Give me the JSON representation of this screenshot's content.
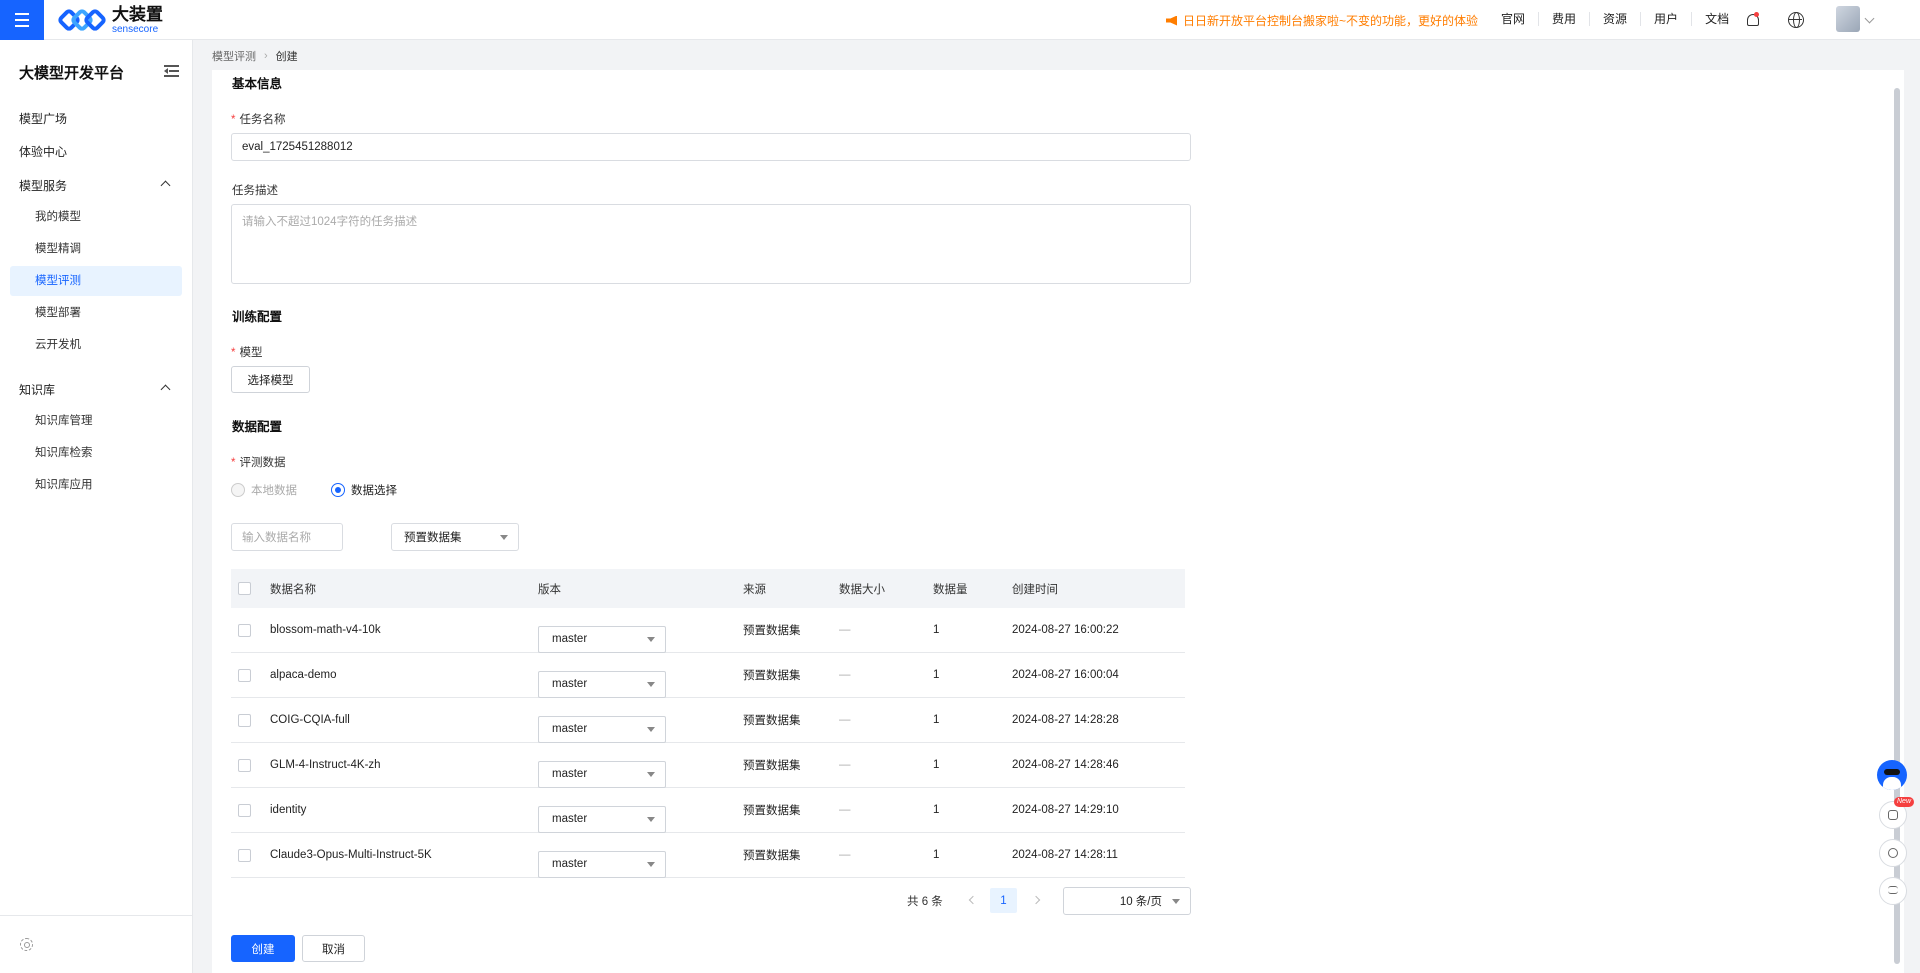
{
  "brand": {
    "name_cn": "大装置",
    "name_en": "sensecore"
  },
  "notice": "日日新开放平台控制台搬家啦~不变的功能，更好的体验",
  "topnav": [
    "官网",
    "费用",
    "资源",
    "用户",
    "文档"
  ],
  "sidebar": {
    "title": "大模型开发平台",
    "top_items": [
      "模型广场",
      "体验中心"
    ],
    "groups": [
      {
        "label": "模型服务",
        "items": [
          "我的模型",
          "模型精调",
          "模型评测",
          "模型部署",
          "云开发机"
        ]
      },
      {
        "label": "知识库",
        "items": [
          "知识库管理",
          "知识库检索",
          "知识库应用"
        ]
      }
    ],
    "active_item": "模型评测"
  },
  "breadcrumb": {
    "parent": "模型评测",
    "current": "创建"
  },
  "form": {
    "basic_title": "基本信息",
    "task_name_label": "任务名称",
    "task_name_value": "eval_1725451288012",
    "task_desc_label": "任务描述",
    "task_desc_placeholder": "请输入不超过1024字符的任务描述",
    "train_title": "训练配置",
    "model_label": "模型",
    "select_model_btn": "选择模型",
    "data_title": "数据配置",
    "eval_data_label": "评测数据",
    "radio_local": "本地数据",
    "radio_select": "数据选择",
    "search_placeholder": "输入数据名称",
    "dataset_type": "预置数据集"
  },
  "table": {
    "headers": [
      "数据名称",
      "版本",
      "来源",
      "数据大小",
      "数据量",
      "创建时间"
    ],
    "rows": [
      {
        "name": "blossom-math-v4-10k",
        "version": "master",
        "source": "预置数据集",
        "size": "—",
        "count": "1",
        "created": "2024-08-27 16:00:22"
      },
      {
        "name": "alpaca-demo",
        "version": "master",
        "source": "预置数据集",
        "size": "—",
        "count": "1",
        "created": "2024-08-27 16:00:04"
      },
      {
        "name": "COIG-CQIA-full",
        "version": "master",
        "source": "预置数据集",
        "size": "—",
        "count": "1",
        "created": "2024-08-27 14:28:28"
      },
      {
        "name": "GLM-4-Instruct-4K-zh",
        "version": "master",
        "source": "预置数据集",
        "size": "—",
        "count": "1",
        "created": "2024-08-27 14:28:46"
      },
      {
        "name": "identity",
        "version": "master",
        "source": "预置数据集",
        "size": "—",
        "count": "1",
        "created": "2024-08-27 14:29:10"
      },
      {
        "name": "Claude3-Opus-Multi-Instruct-5K",
        "version": "master",
        "source": "预置数据集",
        "size": "—",
        "count": "1",
        "created": "2024-08-27 14:28:11"
      }
    ]
  },
  "pagination": {
    "total": "共 6 条",
    "page": "1",
    "page_size": "10 条/页"
  },
  "actions": {
    "create": "创建",
    "cancel": "取消"
  },
  "floating": {
    "badge": "New"
  },
  "colors": {
    "accent": "#1664ff",
    "notice": "#ff7d00",
    "required": "#f53f3f"
  }
}
